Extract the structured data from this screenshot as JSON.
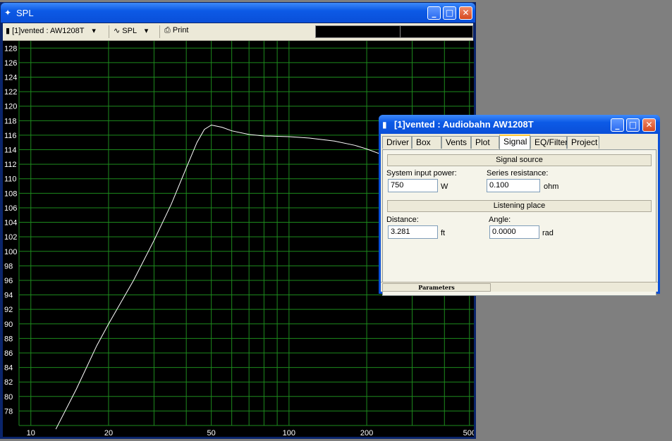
{
  "spl_window": {
    "title": "SPL",
    "toolbar": {
      "project_select": "[1]vented : AW1208T",
      "mode_select": "SPL",
      "print_label": "Print"
    }
  },
  "params_window": {
    "title": "[1]vented : Audiobahn AW1208T",
    "tabs": [
      "Driver",
      "Box",
      "Vents",
      "Plot",
      "Signal",
      "EQ/Filter",
      "Project"
    ],
    "active_tab": "Signal",
    "signal_source": {
      "header": "Signal source",
      "input_power_label": "System input power:",
      "input_power_value": "750",
      "input_power_unit": "W",
      "series_resistance_label": "Series resistance:",
      "series_resistance_value": "0.100",
      "series_resistance_unit": "ohm"
    },
    "listening_place": {
      "header": "Listening place",
      "distance_label": "Distance:",
      "distance_value": "3.281",
      "distance_unit": "ft",
      "angle_label": "Angle:",
      "angle_value": "0.0000",
      "angle_unit": "rad"
    },
    "status": "Parameters"
  },
  "chart_data": {
    "type": "line",
    "x_scale": "log",
    "xlim": [
      9,
      520
    ],
    "ylim": [
      76,
      129
    ],
    "x_ticks": [
      10,
      20,
      50,
      100,
      200,
      500
    ],
    "y_ticks": [
      78,
      80,
      82,
      84,
      86,
      88,
      90,
      92,
      94,
      96,
      98,
      100,
      102,
      104,
      106,
      108,
      110,
      112,
      114,
      116,
      118,
      120,
      122,
      124,
      126,
      128
    ],
    "grid": true,
    "colors": {
      "background": "#000000",
      "grid": "#1d8a1d",
      "curve": "#ffffff",
      "labels": "#ffffff"
    },
    "series": [
      {
        "x": [
          12.5,
          15,
          18,
          20,
          25,
          30,
          35,
          40,
          44,
          47,
          50,
          55,
          60,
          70,
          80,
          100,
          120,
          150,
          180,
          200,
          230,
          250
        ],
        "y": [
          75.5,
          81,
          87,
          90,
          96,
          101.5,
          106.5,
          111.5,
          115,
          116.8,
          117.4,
          117.1,
          116.6,
          116.1,
          115.9,
          115.8,
          115.6,
          115.2,
          114.6,
          114.1,
          113.3,
          112.9
        ]
      }
    ]
  }
}
